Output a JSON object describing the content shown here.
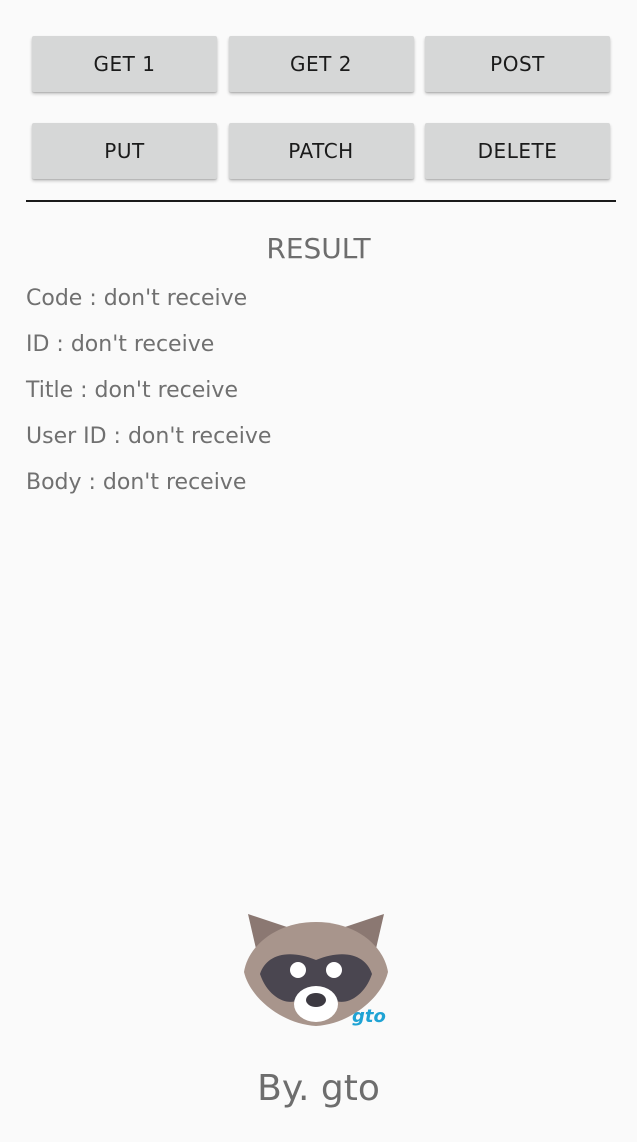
{
  "buttons": {
    "get1": "GET 1",
    "get2": "GET 2",
    "post": "POST",
    "put": "PUT",
    "patch": "PATCH",
    "delete": "DELETE"
  },
  "result": {
    "title": "RESULT",
    "code": "Code : don't receive",
    "id": "ID : don't receive",
    "title_line": "Title : don't receive",
    "user_id": "User ID : don't receive",
    "body": "Body : don't receive"
  },
  "logo": {
    "icon": "raccoon-logo-icon",
    "text": "gto"
  },
  "footer": {
    "text": "By. gto"
  },
  "colors": {
    "background": "#fafafa",
    "button": "#d6d7d7",
    "divider": "#1a1a1a",
    "text": "#707070",
    "raccoon_fur": "#a8958c",
    "raccoon_dark": "#4a4650",
    "logo_blue": "#1fa3d4",
    "logo_yellow": "#f2c318"
  }
}
